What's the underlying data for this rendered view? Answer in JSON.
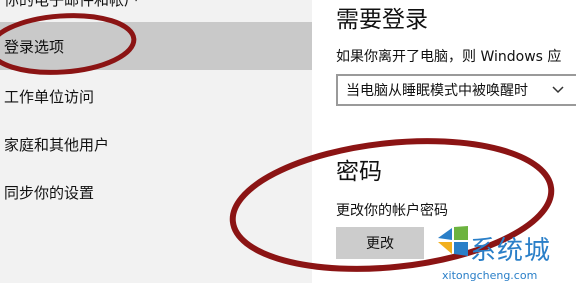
{
  "sidebar": {
    "items": [
      {
        "label": "你的电子邮件和帐户"
      },
      {
        "label": "登录选项"
      },
      {
        "label": "工作单位访问"
      },
      {
        "label": "家庭和其他用户"
      },
      {
        "label": "同步你的设置"
      }
    ]
  },
  "main": {
    "require_signin": {
      "title": "需要登录",
      "description": "如果你离开了电脑，则 Windows 应",
      "dropdown_value": "当电脑从睡眠模式中被唤醒时"
    },
    "password": {
      "title": "密码",
      "description": "更改你的帐户密码",
      "button_label": "更改"
    }
  },
  "watermark": {
    "text": "系统城",
    "url": "xitongcheng.com"
  },
  "colors": {
    "annotation": "#8b1414",
    "selected_bg": "#c9c9c9",
    "watermark_blue": "#2a7fc8"
  },
  "icons": {
    "dropdown": "chevron-down-icon",
    "watermark_logo": "windows-logo-icon"
  }
}
